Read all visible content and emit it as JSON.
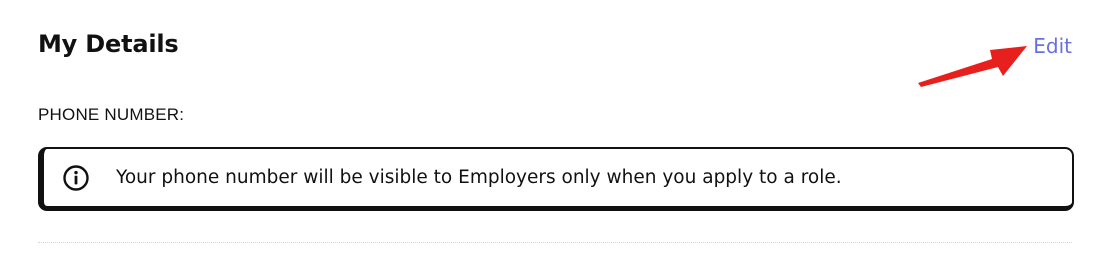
{
  "section": {
    "title": "My Details",
    "edit_label": "Edit"
  },
  "phone": {
    "label": "PHONE NUMBER:",
    "notice": "Your phone number will be visible to Employers only when you apply to a role.",
    "notice_icon": "info-icon"
  },
  "colors": {
    "link": "#6a6fe0",
    "annotation_arrow": "#e8201d",
    "border": "#111111"
  }
}
